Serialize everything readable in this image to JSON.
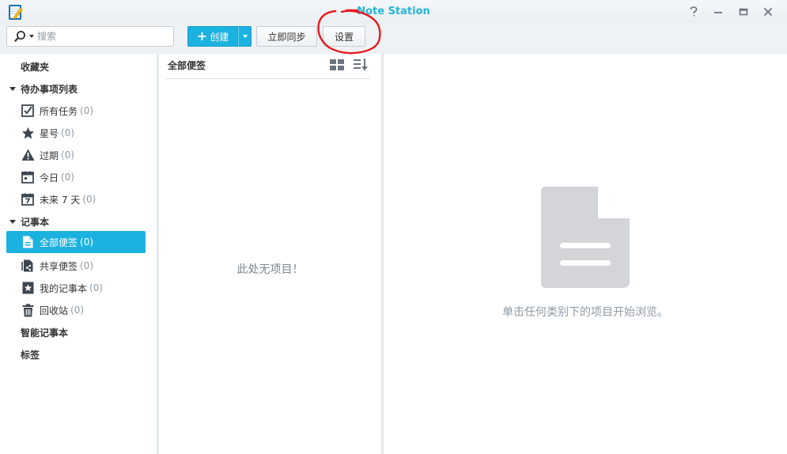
{
  "window": {
    "title": "Note Station",
    "help_glyph": "?",
    "minimize_glyph": "—",
    "maximize_glyph": "▭",
    "close_glyph": "✕"
  },
  "toolbar": {
    "search_placeholder": "搜索",
    "create_label": "创建",
    "create_plus": "+",
    "sync_label": "立即同步",
    "settings_label": "设置"
  },
  "sidebar": {
    "favorites": "收藏夹",
    "todo_header": "待办事项列表",
    "todo_items": [
      {
        "label": "所有任务",
        "count": "(0)",
        "icon": "checkbox-icon"
      },
      {
        "label": "星号",
        "count": "(0)",
        "icon": "star-icon"
      },
      {
        "label": "过期",
        "count": "(0)",
        "icon": "warning-icon"
      },
      {
        "label": "今日",
        "count": "(0)",
        "icon": "calendar-today-icon"
      },
      {
        "label": "未来 7 天",
        "count": "(0)",
        "icon": "calendar-week-icon"
      }
    ],
    "notebook_header": "记事本",
    "notebook_items": [
      {
        "label": "全部便签",
        "count": "(0)",
        "icon": "note-icon",
        "active": true
      },
      {
        "label": "共享便签",
        "count": "(0)",
        "icon": "shared-note-icon"
      },
      {
        "label": "我的记事本",
        "count": "(0)",
        "icon": "my-notebook-icon"
      },
      {
        "label": "回收站",
        "count": "(0)",
        "icon": "trash-icon"
      }
    ],
    "smart_notebook": "智能记事本",
    "tags": "标签"
  },
  "list": {
    "header": "全部便签",
    "empty_text": "此处无项目！"
  },
  "detail": {
    "hint": "单击任何类别下的项目开始浏览。"
  },
  "colors": {
    "accent": "#1cb2e0",
    "title": "#22b5d8",
    "annotation": "#e8191f"
  }
}
